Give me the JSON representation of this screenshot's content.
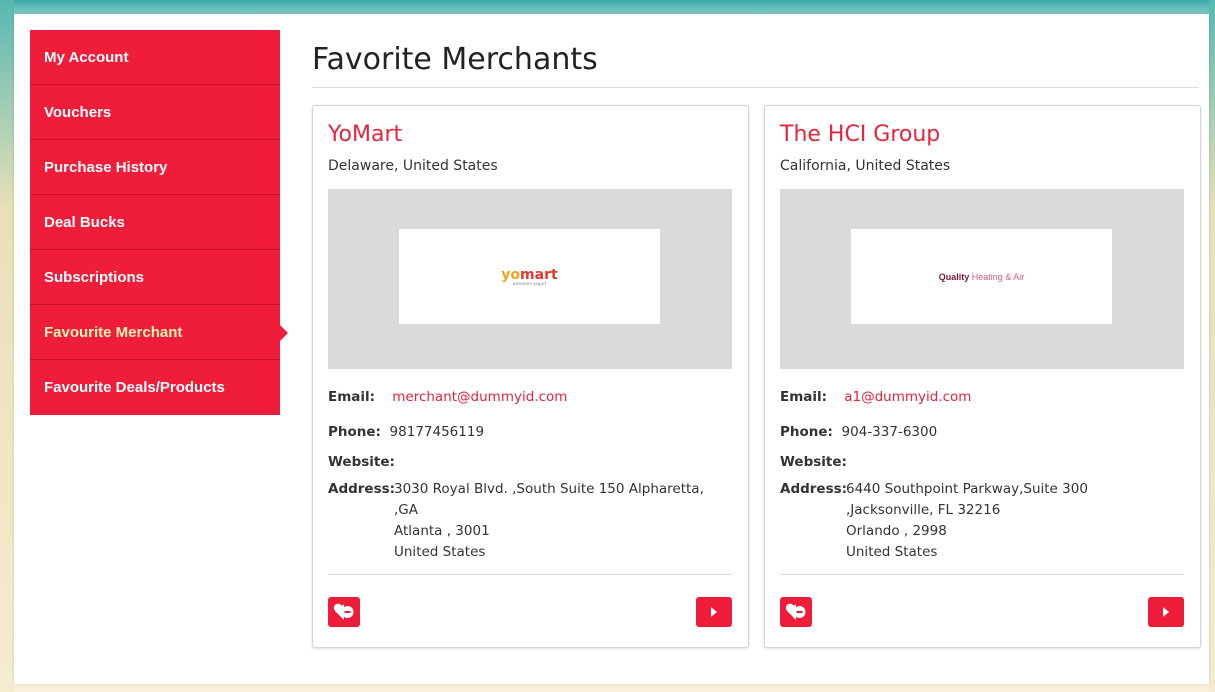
{
  "sidebar": {
    "items": [
      {
        "label": "My Account",
        "active": false
      },
      {
        "label": "Vouchers",
        "active": false
      },
      {
        "label": "Purchase History",
        "active": false
      },
      {
        "label": "Deal Bucks",
        "active": false
      },
      {
        "label": "Subscriptions",
        "active": false
      },
      {
        "label": "Favourite Merchant",
        "active": true
      },
      {
        "label": "Favourite Deals/Products",
        "active": false
      }
    ]
  },
  "page": {
    "title": "Favorite Merchants"
  },
  "labels": {
    "email": "Email:",
    "phone": "Phone:",
    "website": "Website:",
    "address": "Address:"
  },
  "merchants": [
    {
      "name": "YoMart",
      "location": "Delaware, United States",
      "logo": {
        "part1": "yo",
        "part2": "mart",
        "tagline": "awesome yogurt"
      },
      "email": "merchant@dummyid.com",
      "phone": "98177456119",
      "website": "",
      "address": [
        "3030 Royal Blvd. ,South Suite 150 Alpharetta,",
        ",GA",
        "Atlanta , 3001",
        "United States"
      ]
    },
    {
      "name": "The HCI Group",
      "location": "California, United States",
      "logo": {
        "part1": "Quality",
        "part2": "Heating & Air"
      },
      "email": "a1@dummyid.com",
      "phone": "904-337-6300",
      "website": "",
      "address": [
        "6440 Southpoint Parkway,Suite 300",
        ",Jacksonville, FL 32216",
        "Orlando , 2998",
        "United States"
      ]
    }
  ],
  "icons": {
    "favorite_remove": "heart-minus-icon",
    "view": "play-arrow-icon"
  },
  "colors": {
    "accent": "#ef1c3a",
    "link": "#e5243b",
    "active_text": "#fff4b3"
  }
}
